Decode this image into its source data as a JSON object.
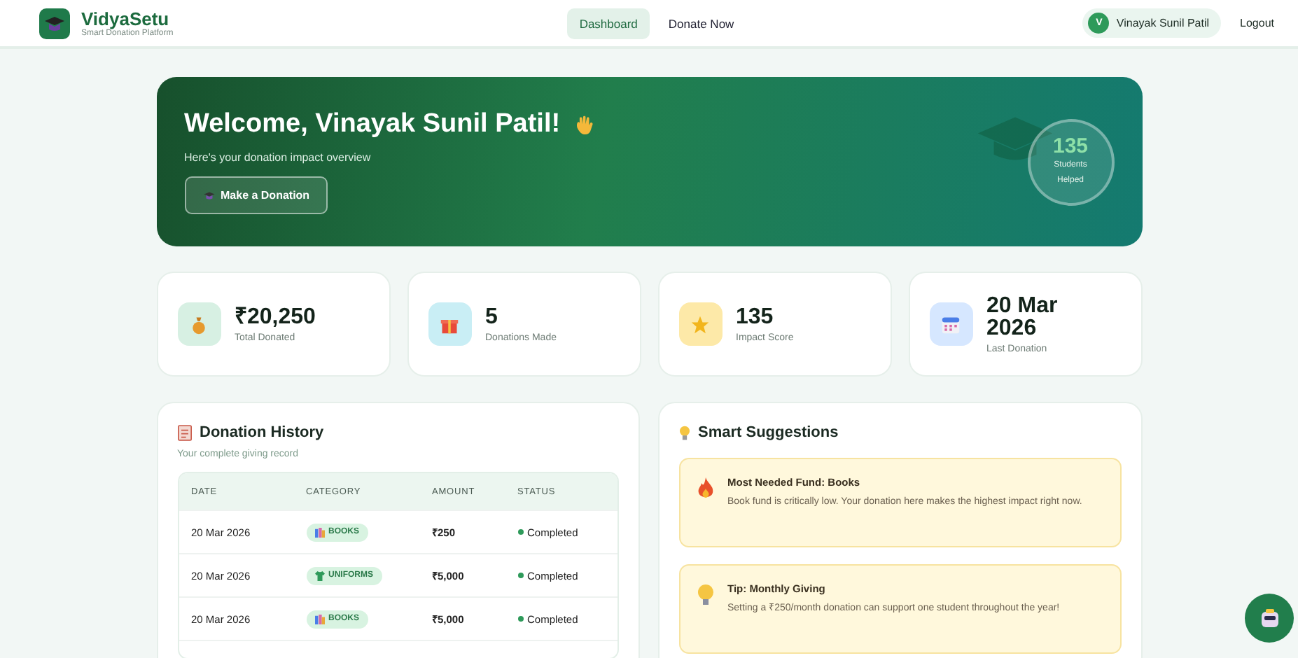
{
  "header": {
    "brand": "VidyaSetu",
    "tagline": "Smart Donation Platform",
    "nav": [
      {
        "label": "Dashboard",
        "selected": true
      },
      {
        "label": "Donate Now",
        "selected": false
      }
    ],
    "user": {
      "initial": "V",
      "name": "Vinayak Sunil Patil"
    },
    "logout": "Logout"
  },
  "hero": {
    "title": "Welcome, Vinayak Sunil Patil!",
    "subtitle": "Here's your donation impact overview",
    "button": "Make a Donation",
    "badge": {
      "value": "135",
      "label": "Students Helped"
    }
  },
  "stats": [
    {
      "kind": "bag",
      "color": "#d7f0e3",
      "value": "₹20,250",
      "label": "Total Donated"
    },
    {
      "kind": "gift",
      "color": "#c9eef5",
      "value": "5",
      "label": "Donations Made"
    },
    {
      "kind": "star",
      "color": "#fde9a8",
      "value": "135",
      "label": "Impact Score"
    },
    {
      "kind": "calendar",
      "color": "#d6e7ff",
      "value": "20 Mar 2026",
      "label": "Last Donation"
    }
  ],
  "history": {
    "title": "Donation History",
    "subtitle": "Your complete giving record",
    "columns": [
      "DATE",
      "CATEGORY",
      "AMOUNT",
      "STATUS"
    ],
    "rows": [
      {
        "date": "20 Mar 2026",
        "category": {
          "kind": "books",
          "label": "BOOKS"
        },
        "amount": "₹250",
        "status": "Completed"
      },
      {
        "date": "20 Mar 2026",
        "category": {
          "kind": "uniforms",
          "label": "UNIFORMS"
        },
        "amount": "₹5,000",
        "status": "Completed"
      },
      {
        "date": "20 Mar 2026",
        "category": {
          "kind": "books",
          "label": "BOOKS"
        },
        "amount": "₹5,000",
        "status": "Completed"
      }
    ]
  },
  "suggestions": {
    "title": "Smart Suggestions",
    "items": [
      {
        "kind": "fire",
        "title": "Most Needed Fund: Books",
        "text": "Book fund is critically low. Your donation here makes the highest impact right now."
      },
      {
        "kind": "bulb",
        "title": "Tip: Monthly Giving",
        "text": "Setting a ₹250/month donation can support one student throughout the year!"
      }
    ]
  }
}
